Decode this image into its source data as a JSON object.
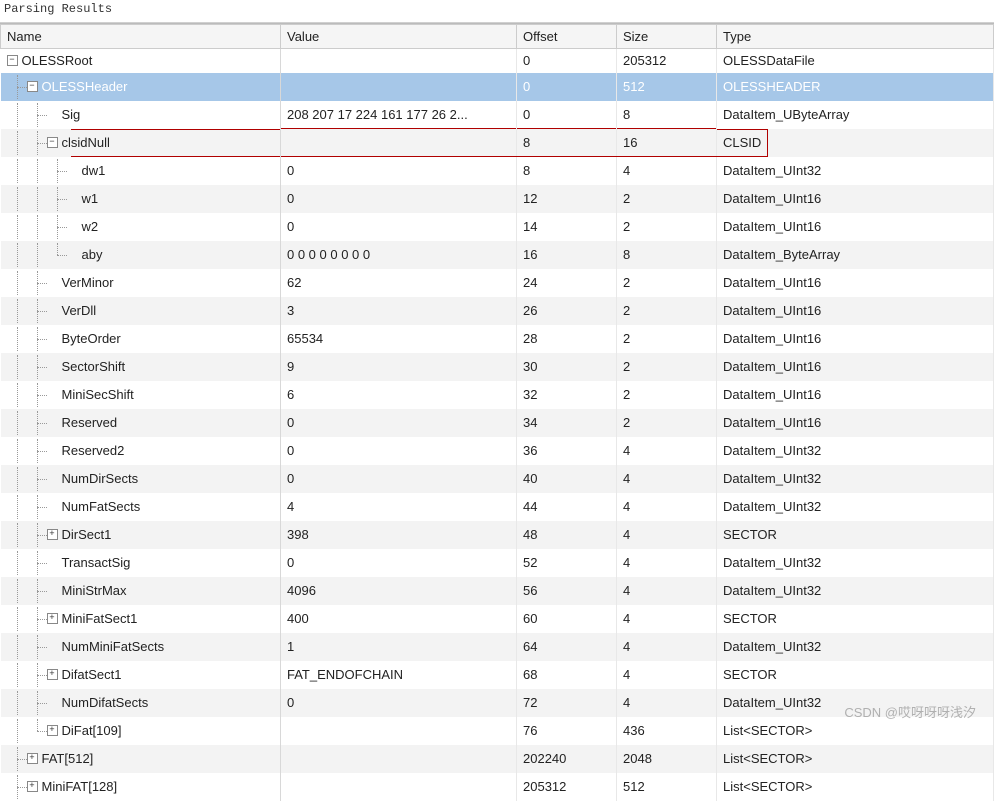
{
  "title": "Parsing Results",
  "columns": {
    "name": "Name",
    "value": "Value",
    "offset": "Offset",
    "size": "Size",
    "type": "Type"
  },
  "rows": [
    {
      "depth": 0,
      "toggle": "minus",
      "name": "OLESSRoot",
      "value": "",
      "offset": "0",
      "size": "205312",
      "type": "OLESSDataFile",
      "alt": false
    },
    {
      "depth": 1,
      "toggle": "minus",
      "name": "OLESSHeader",
      "value": "",
      "offset": "0",
      "size": "512",
      "type": "OLESSHEADER",
      "alt": false,
      "selected": true
    },
    {
      "depth": 2,
      "toggle": "",
      "name": "Sig",
      "value": "208 207 17 224 161 177 26 2...",
      "offset": "0",
      "size": "8",
      "type": "DataItem_UByteArray",
      "alt": false
    },
    {
      "depth": 2,
      "toggle": "minus",
      "name": "clsidNull",
      "value": "",
      "offset": "8",
      "size": "16",
      "type": "CLSID",
      "alt": true,
      "highlighted": true
    },
    {
      "depth": 3,
      "toggle": "",
      "name": "dw1",
      "value": "0",
      "offset": "8",
      "size": "4",
      "type": "DataItem_UInt32",
      "alt": false
    },
    {
      "depth": 3,
      "toggle": "",
      "name": "w1",
      "value": "0",
      "offset": "12",
      "size": "2",
      "type": "DataItem_UInt16",
      "alt": true
    },
    {
      "depth": 3,
      "toggle": "",
      "name": "w2",
      "value": "0",
      "offset": "14",
      "size": "2",
      "type": "DataItem_UInt16",
      "alt": false
    },
    {
      "depth": 3,
      "toggle": "",
      "name": "aby",
      "value": "0 0 0 0 0 0 0 0",
      "offset": "16",
      "size": "8",
      "type": "DataItem_ByteArray",
      "alt": true,
      "last": true
    },
    {
      "depth": 2,
      "toggle": "",
      "name": "VerMinor",
      "value": "62",
      "offset": "24",
      "size": "2",
      "type": "DataItem_UInt16",
      "alt": false
    },
    {
      "depth": 2,
      "toggle": "",
      "name": "VerDll",
      "value": "3",
      "offset": "26",
      "size": "2",
      "type": "DataItem_UInt16",
      "alt": true
    },
    {
      "depth": 2,
      "toggle": "",
      "name": "ByteOrder",
      "value": "65534",
      "offset": "28",
      "size": "2",
      "type": "DataItem_UInt16",
      "alt": false
    },
    {
      "depth": 2,
      "toggle": "",
      "name": "SectorShift",
      "value": "9",
      "offset": "30",
      "size": "2",
      "type": "DataItem_UInt16",
      "alt": true
    },
    {
      "depth": 2,
      "toggle": "",
      "name": "MiniSecShift",
      "value": "6",
      "offset": "32",
      "size": "2",
      "type": "DataItem_UInt16",
      "alt": false
    },
    {
      "depth": 2,
      "toggle": "",
      "name": "Reserved",
      "value": "0",
      "offset": "34",
      "size": "2",
      "type": "DataItem_UInt16",
      "alt": true
    },
    {
      "depth": 2,
      "toggle": "",
      "name": "Reserved2",
      "value": "0",
      "offset": "36",
      "size": "4",
      "type": "DataItem_UInt32",
      "alt": false
    },
    {
      "depth": 2,
      "toggle": "",
      "name": "NumDirSects",
      "value": "0",
      "offset": "40",
      "size": "4",
      "type": "DataItem_UInt32",
      "alt": true
    },
    {
      "depth": 2,
      "toggle": "",
      "name": "NumFatSects",
      "value": "4",
      "offset": "44",
      "size": "4",
      "type": "DataItem_UInt32",
      "alt": false
    },
    {
      "depth": 2,
      "toggle": "plus",
      "name": "DirSect1",
      "value": "398",
      "offset": "48",
      "size": "4",
      "type": "SECTOR",
      "alt": true
    },
    {
      "depth": 2,
      "toggle": "",
      "name": "TransactSig",
      "value": "0",
      "offset": "52",
      "size": "4",
      "type": "DataItem_UInt32",
      "alt": false
    },
    {
      "depth": 2,
      "toggle": "",
      "name": "MiniStrMax",
      "value": "4096",
      "offset": "56",
      "size": "4",
      "type": "DataItem_UInt32",
      "alt": true
    },
    {
      "depth": 2,
      "toggle": "plus",
      "name": "MiniFatSect1",
      "value": "400",
      "offset": "60",
      "size": "4",
      "type": "SECTOR",
      "alt": false
    },
    {
      "depth": 2,
      "toggle": "",
      "name": "NumMiniFatSects",
      "value": "1",
      "offset": "64",
      "size": "4",
      "type": "DataItem_UInt32",
      "alt": true
    },
    {
      "depth": 2,
      "toggle": "plus",
      "name": "DifatSect1",
      "value": "FAT_ENDOFCHAIN",
      "offset": "68",
      "size": "4",
      "type": "SECTOR",
      "alt": false
    },
    {
      "depth": 2,
      "toggle": "",
      "name": "NumDifatSects",
      "value": "0",
      "offset": "72",
      "size": "4",
      "type": "DataItem_UInt32",
      "alt": true
    },
    {
      "depth": 2,
      "toggle": "plus",
      "name": "DiFat[109]",
      "value": "",
      "offset": "76",
      "size": "436",
      "type": "List<SECTOR>",
      "alt": false,
      "last": true
    },
    {
      "depth": 1,
      "toggle": "plus",
      "name": "FAT[512]",
      "value": "",
      "offset": "202240",
      "size": "2048",
      "type": "List<SECTOR>",
      "alt": true
    },
    {
      "depth": 1,
      "toggle": "plus",
      "name": "MiniFAT[128]",
      "value": "",
      "offset": "205312",
      "size": "512",
      "type": "List<SECTOR>",
      "alt": false
    }
  ],
  "watermark": "CSDN @哎呀呀呀浅汐"
}
